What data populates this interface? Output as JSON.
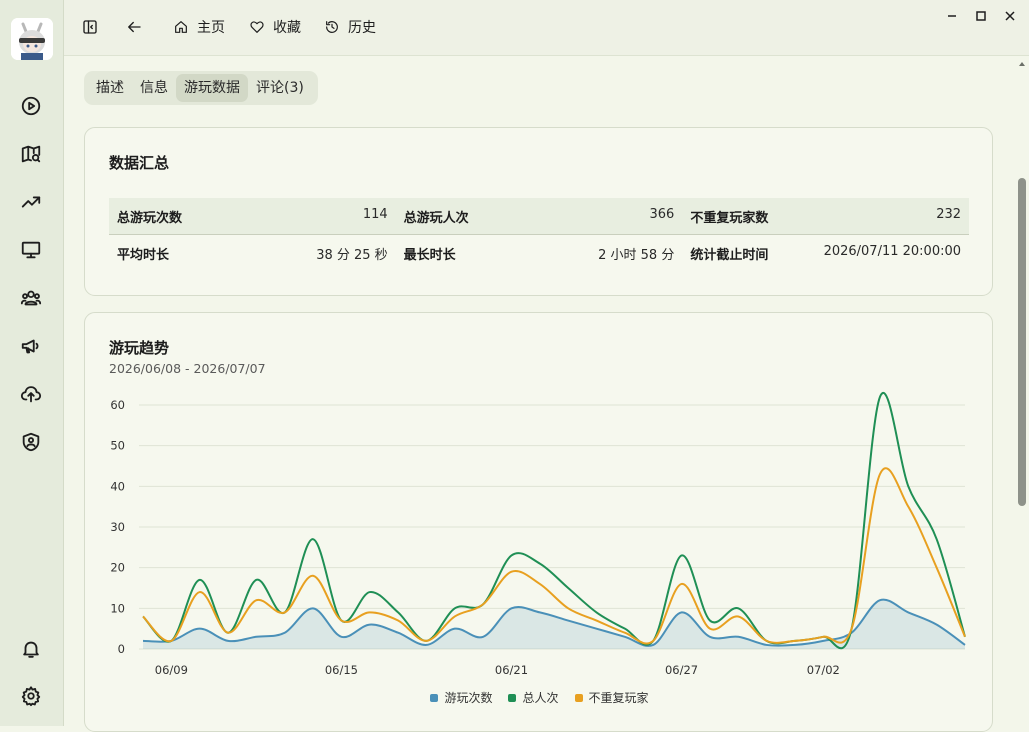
{
  "nav": {
    "home": "主页",
    "favorites": "收藏",
    "history": "历史"
  },
  "tabs": [
    {
      "label": "描述",
      "active": false
    },
    {
      "label": "信息",
      "active": false
    },
    {
      "label": "游玩数据",
      "active": true
    },
    {
      "label": "评论(3)",
      "active": false
    }
  ],
  "summary": {
    "title": "数据汇总",
    "rows": [
      [
        {
          "label": "总游玩次数",
          "value": "114"
        },
        {
          "label": "总游玩人次",
          "value": "366"
        },
        {
          "label": "不重复玩家数",
          "value": "232"
        }
      ],
      [
        {
          "label": "平均时长",
          "value": "38 分 25 秒"
        },
        {
          "label": "最长时长",
          "value": "2 小时 58 分"
        },
        {
          "label": "统计截止时间",
          "value": "2026/07/11 20:00:00"
        }
      ]
    ]
  },
  "trend": {
    "title": "游玩趋势",
    "range": "2026/06/08 - 2026/07/07"
  },
  "colors": {
    "plays": "#4a90b8",
    "total": "#1f8f55",
    "unique": "#e8a020",
    "accent": "#f3f6ea"
  },
  "chart_data": {
    "type": "line",
    "x": [
      "06/08",
      "06/09",
      "06/10",
      "06/11",
      "06/12",
      "06/13",
      "06/14",
      "06/15",
      "06/16",
      "06/17",
      "06/18",
      "06/19",
      "06/20",
      "06/21",
      "06/22",
      "06/23",
      "06/24",
      "06/25",
      "06/26",
      "06/27",
      "06/28",
      "06/29",
      "06/30",
      "07/01",
      "07/02",
      "07/03",
      "07/04",
      "07/05",
      "07/06",
      "07/07"
    ],
    "xticks": [
      "06/09",
      "06/15",
      "06/21",
      "06/27",
      "07/02"
    ],
    "ylim": [
      0,
      60
    ],
    "yticks": [
      0,
      10,
      20,
      30,
      40,
      50,
      60
    ],
    "series": [
      {
        "name": "游玩次数",
        "values": [
          2,
          2,
          5,
          2,
          3,
          4,
          10,
          3,
          6,
          4,
          1,
          5,
          3,
          10,
          9,
          7,
          5,
          3,
          1,
          9,
          3,
          3,
          1,
          1,
          2,
          4,
          12,
          9,
          6,
          1
        ]
      },
      {
        "name": "总人次",
        "values": [
          8,
          2,
          17,
          4,
          17,
          9,
          27,
          7,
          14,
          9,
          2,
          10,
          11,
          23,
          21,
          15,
          9,
          5,
          2,
          23,
          7,
          10,
          2,
          2,
          3,
          5,
          62,
          40,
          27,
          3
        ]
      },
      {
        "name": "不重复玩家",
        "values": [
          8,
          2,
          14,
          4,
          12,
          9,
          18,
          7,
          9,
          7,
          2,
          8,
          11,
          19,
          16,
          10,
          7,
          4,
          2,
          16,
          5,
          8,
          2,
          2,
          3,
          5,
          43,
          35,
          20,
          3
        ]
      }
    ]
  }
}
